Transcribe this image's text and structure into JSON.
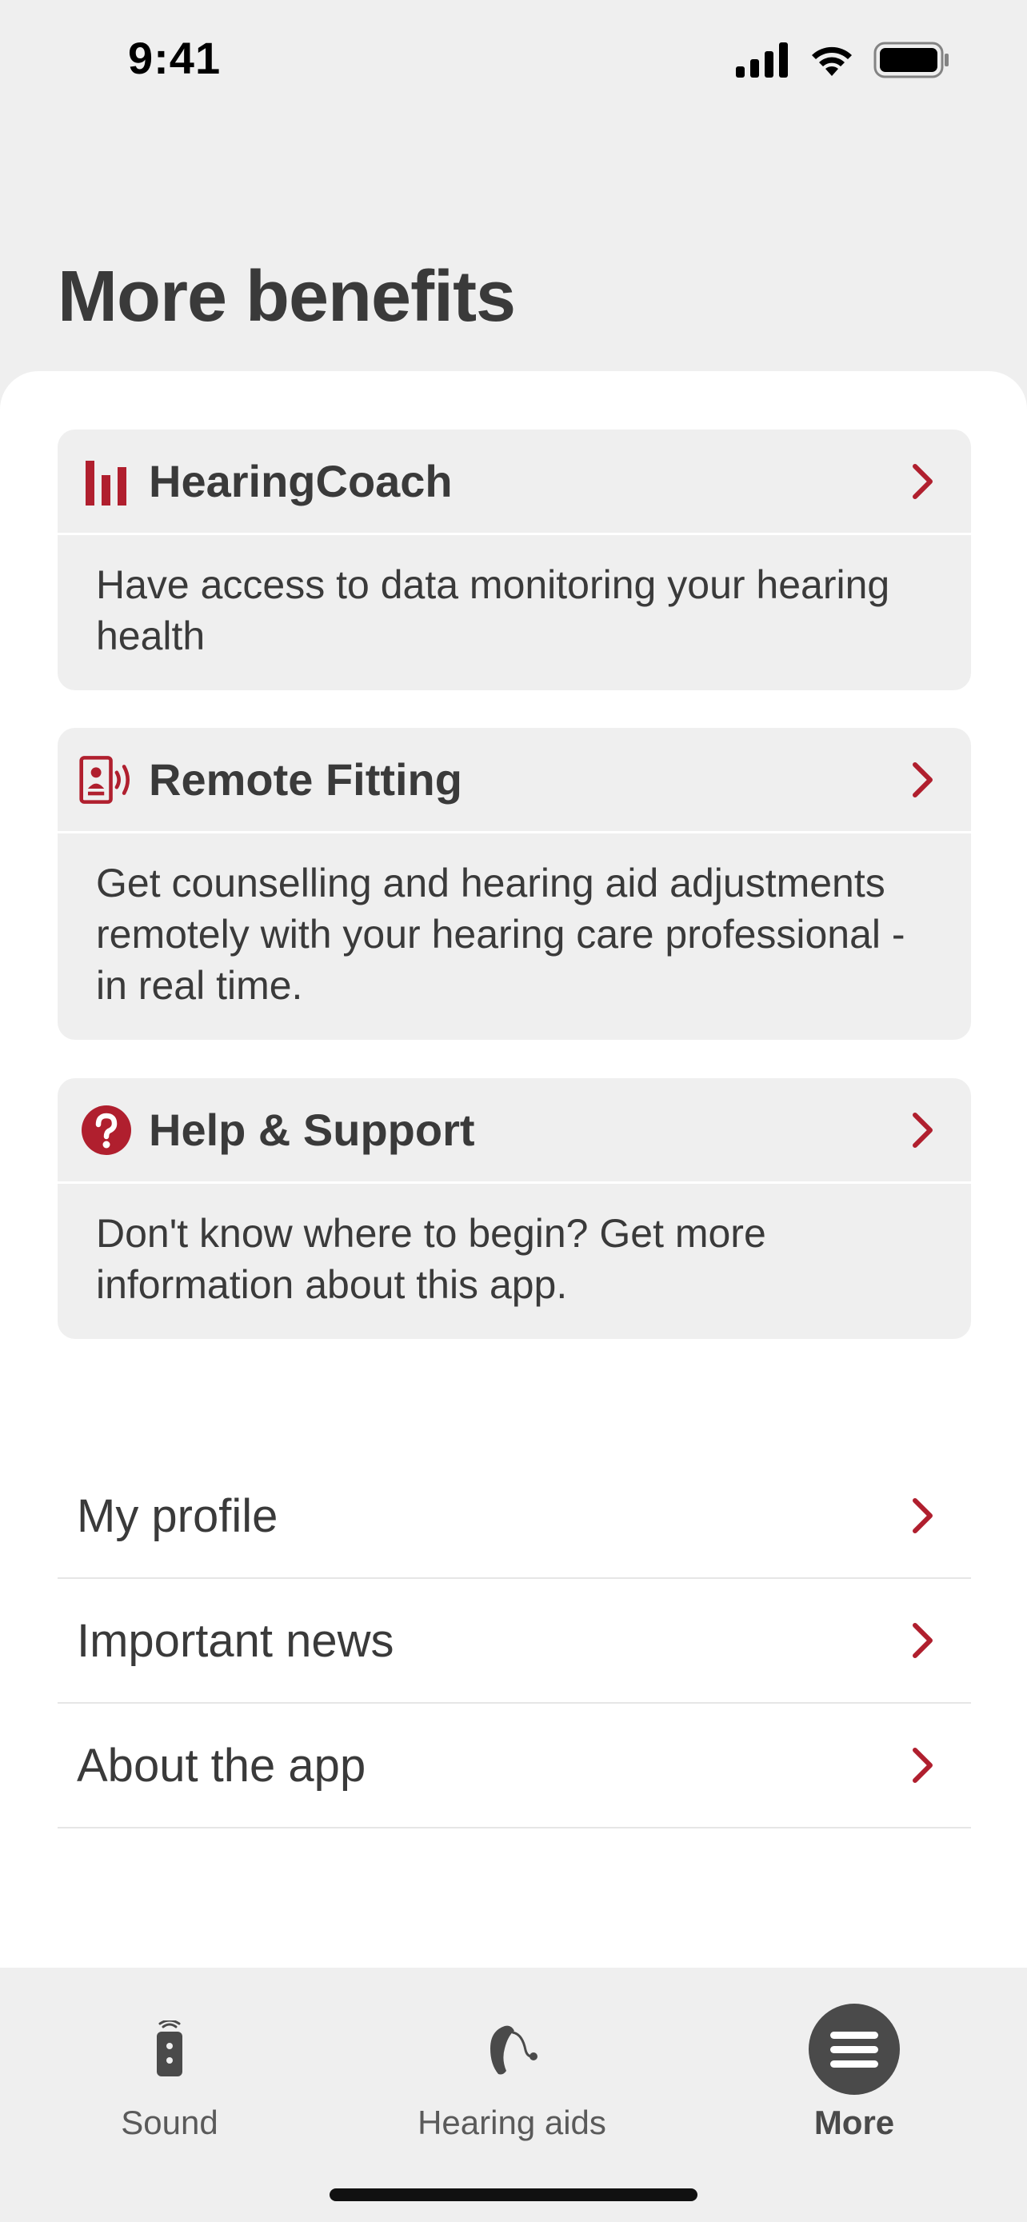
{
  "status_bar": {
    "time": "9:41"
  },
  "page": {
    "title": "More benefits"
  },
  "cards": [
    {
      "title": "HearingCoach",
      "icon": "bar-chart-icon",
      "description": "Have access to data monitoring your hearing health"
    },
    {
      "title": "Remote Fitting",
      "icon": "remote-fitting-icon",
      "description": "Get counselling and hearing aid adjustments remotely with your hearing care professional - in real time."
    },
    {
      "title": "Help & Support",
      "icon": "question-icon",
      "description": "Don't know where to begin? Get more information about this app."
    }
  ],
  "list": [
    {
      "label": "My profile"
    },
    {
      "label": "Important news"
    },
    {
      "label": "About the app"
    }
  ],
  "tabs": [
    {
      "label": "Sound",
      "icon": "remote-control-icon",
      "active": false
    },
    {
      "label": "Hearing aids",
      "icon": "hearing-aid-icon",
      "active": false
    },
    {
      "label": "More",
      "icon": "menu-icon",
      "active": true
    }
  ],
  "colors": {
    "accent": "#b01f2e",
    "background": "#efefef",
    "text": "#3a3a3a"
  }
}
